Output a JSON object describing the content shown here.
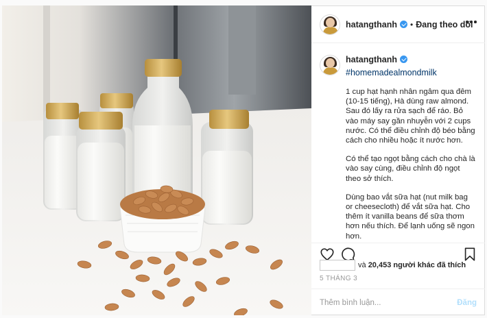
{
  "header": {
    "username": "hatangthanh",
    "separator": "•",
    "follow_status": "Đang theo dõi",
    "more_icon": "more-horizontal-icon",
    "verified_icon": "verified-badge-icon"
  },
  "photo": {
    "subject": "almond-milk-photo"
  },
  "caption": {
    "username": "hatangthanh",
    "hashtag": "#homemadealmondmilk",
    "paragraphs": [
      "1 cup hạt hạnh nhân ngâm qua đêm (10-15 tiếng), Hà dùng raw almond. Sau đó lấy ra rửa sạch để ráo. Bỏ vào máy say gần nhuyễn với 2 cups nước. Có thể điều chỉnh độ béo bằng cách cho nhiều hoặc ít nước hơn.",
      "Có thể tạo ngọt bằng cách cho chà là vào say cùng, điều chỉnh độ ngọt theo sở thích.",
      "Dùng bao vắt sữa hạt (nut milk bag or cheesecloth) để vắt sữa hạt. Cho thêm ít vanilla beans để sữa thơm hơn nếu thích. Để lạnh uống sẽ ngon hơn."
    ]
  },
  "actions": {
    "like_icon": "heart-icon",
    "comment_icon": "comment-icon",
    "save_icon": "bookmark-icon"
  },
  "likes": {
    "connector": "và",
    "count": "20,453",
    "suffix": "người khác đã thích"
  },
  "date": "5 THÁNG 3",
  "comment": {
    "placeholder": "Thêm bình luận...",
    "post_label": "Đăng"
  },
  "colors": {
    "accent": "#3897f0",
    "hashtag": "#003569",
    "post_disabled": "#b2dffc",
    "border": "#dbdbdb"
  }
}
